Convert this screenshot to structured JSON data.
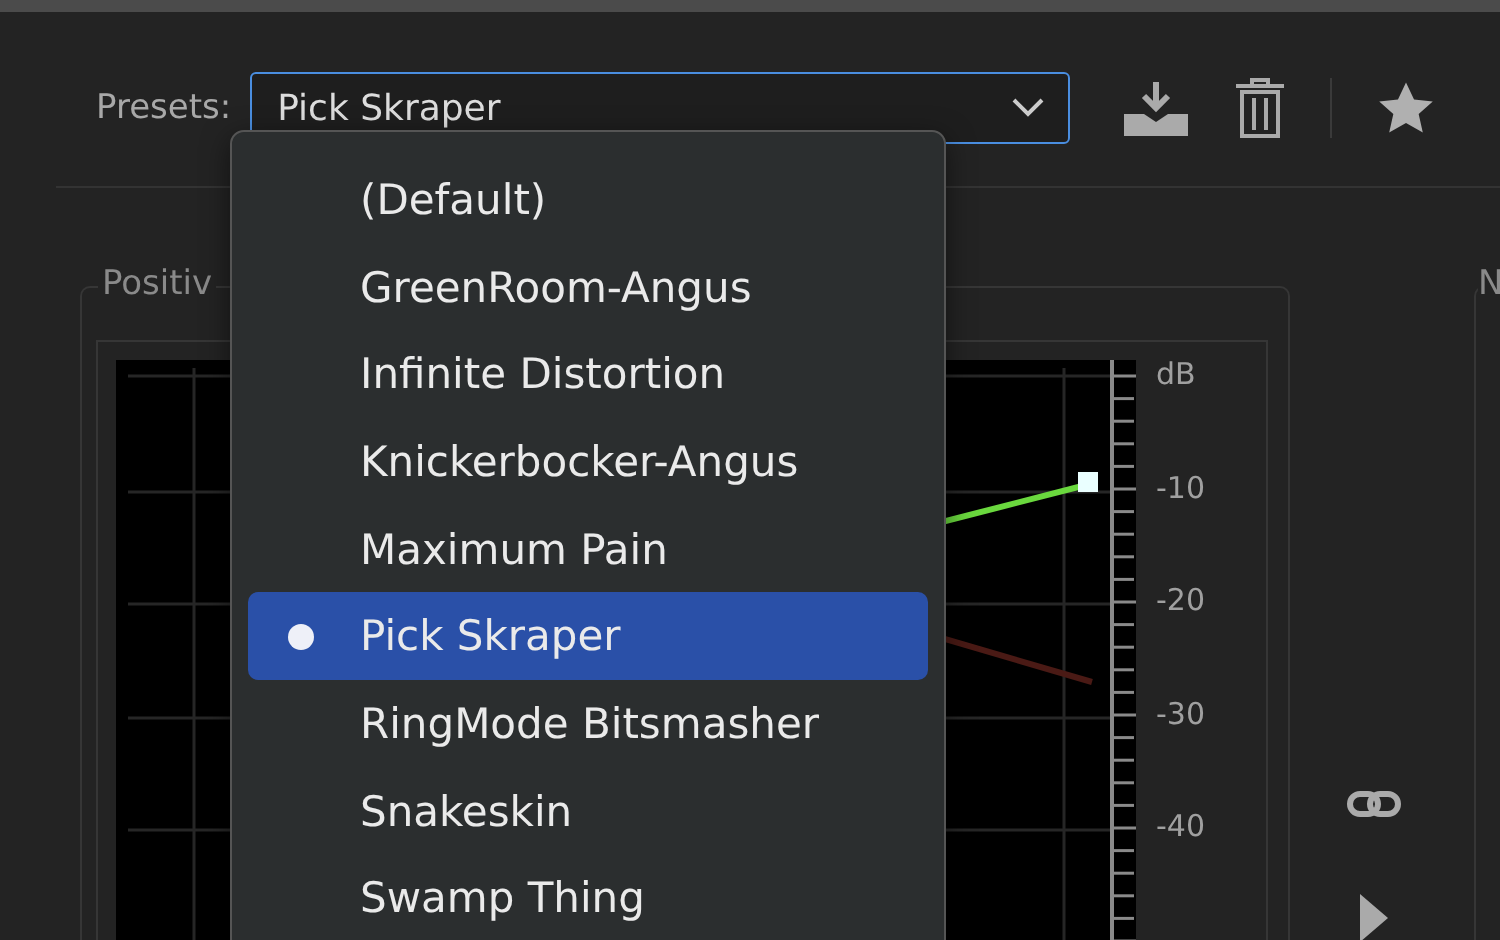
{
  "presets": {
    "label": "Presets:",
    "value": "Pick Skraper",
    "expanded": true
  },
  "menu": [
    {
      "label": "(Default)",
      "selected": false
    },
    {
      "label": "GreenRoom-Angus",
      "selected": false
    },
    {
      "label": "Infinite Distortion",
      "selected": false
    },
    {
      "label": "Knickerbocker-Angus",
      "selected": false
    },
    {
      "label": "Maximum Pain",
      "selected": false
    },
    {
      "label": "Pick Skraper",
      "selected": true
    },
    {
      "label": "RingMode Bitsmasher",
      "selected": false
    },
    {
      "label": "Snakeskin",
      "selected": false
    },
    {
      "label": "Swamp Thing",
      "selected": false
    }
  ],
  "left_panel": {
    "title": "Positiv",
    "scale": [
      "dB",
      "-10",
      "-20",
      "-30",
      "-40"
    ]
  },
  "right_panel": {
    "title": "N"
  }
}
